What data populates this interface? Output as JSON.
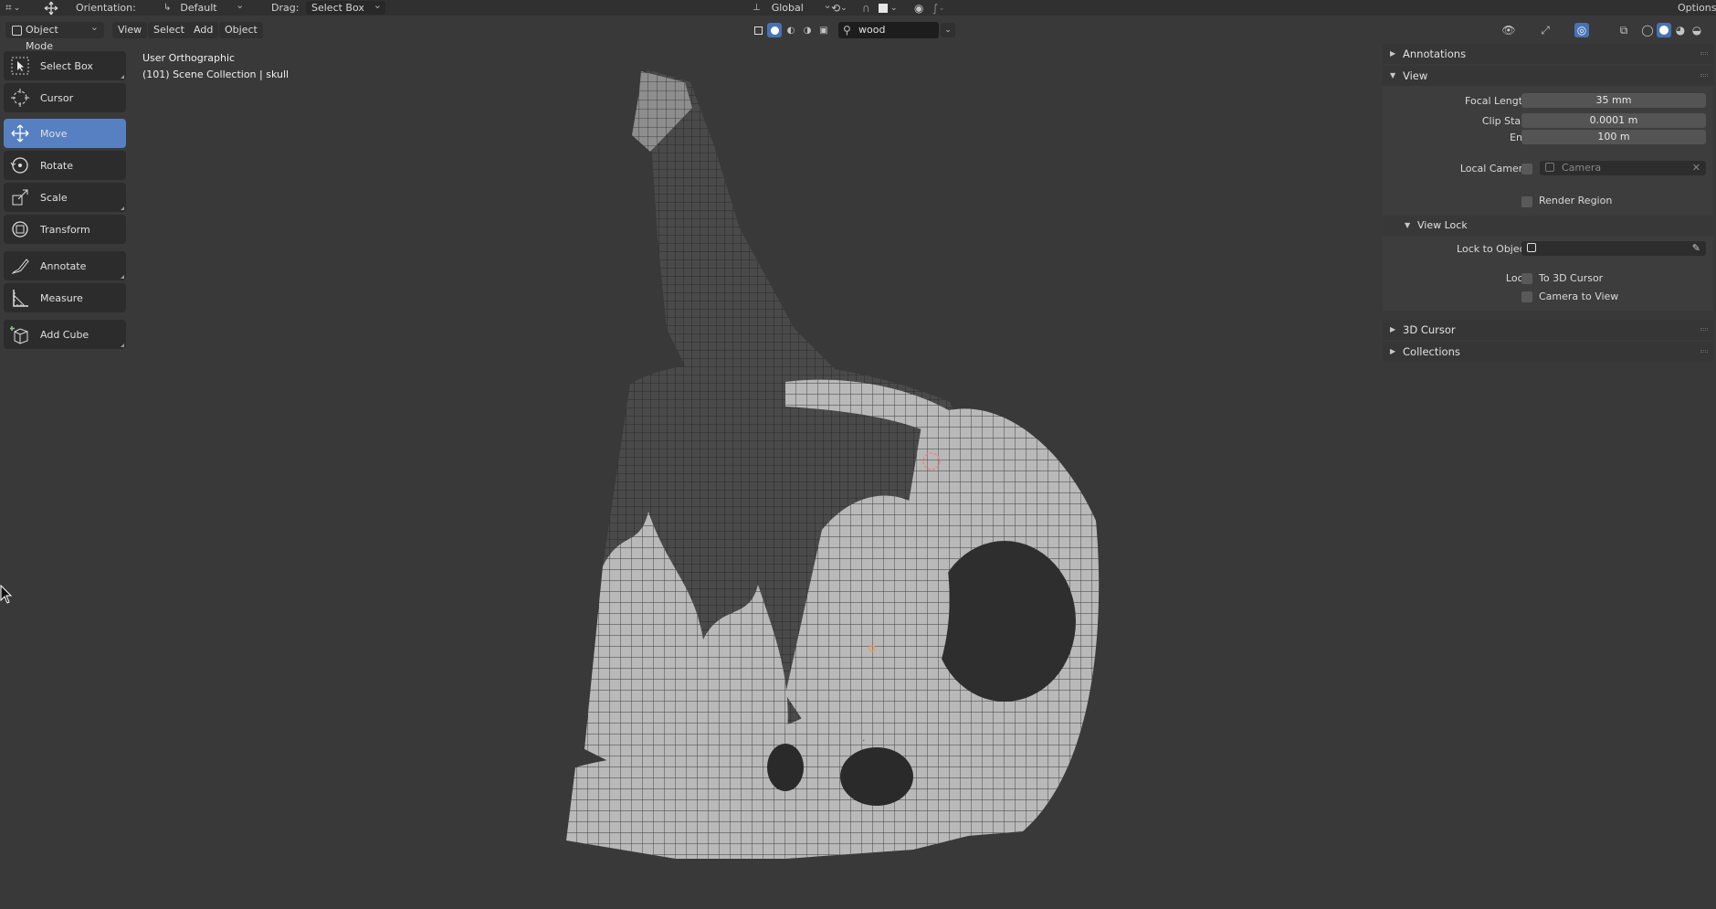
{
  "topbar": {
    "orientation_label": "Orientation:",
    "orientation_value": "Default",
    "drag_label": "Drag:",
    "drag_value": "Select Box",
    "transform_orientation": "Global",
    "options_label": "Options"
  },
  "header": {
    "mode": "Object Mode",
    "menus": [
      "View",
      "Select",
      "Add",
      "Object"
    ],
    "search_value": "wood"
  },
  "viewport": {
    "view_name": "User Orthographic",
    "collection_info": "(101) Scene Collection | skull"
  },
  "tools": [
    {
      "label": "Select Box",
      "icon": "select-box-icon"
    },
    {
      "label": "Cursor",
      "icon": "cursor-icon"
    },
    {
      "label": "Move",
      "icon": "move-icon",
      "active": true
    },
    {
      "label": "Rotate",
      "icon": "rotate-icon"
    },
    {
      "label": "Scale",
      "icon": "scale-icon"
    },
    {
      "label": "Transform",
      "icon": "transform-icon"
    },
    {
      "label": "Annotate",
      "icon": "annotate-icon"
    },
    {
      "label": "Measure",
      "icon": "measure-icon"
    },
    {
      "label": "Add Cube",
      "icon": "add-cube-icon"
    }
  ],
  "sidebar": {
    "annotations": "Annotations",
    "view": "View",
    "focal_length_label": "Focal Length",
    "focal_length_value": "35 mm",
    "clip_start_label": "Clip Start",
    "clip_start_value": "0.0001 m",
    "end_label": "End",
    "end_value": "100 m",
    "local_camera_label": "Local Camera",
    "camera_placeholder": "Camera",
    "render_region": "Render Region",
    "view_lock": "View Lock",
    "lock_to_object_label": "Lock to Object",
    "lock_label": "Lock",
    "to_3d_cursor": "To 3D Cursor",
    "camera_to_view": "Camera to View",
    "cursor_3d": "3D Cursor",
    "collections": "Collections"
  },
  "colors": {
    "viewport_bg": "#393939",
    "active_tool": "#5680c2",
    "panel_bg": "#3d3d3d"
  }
}
